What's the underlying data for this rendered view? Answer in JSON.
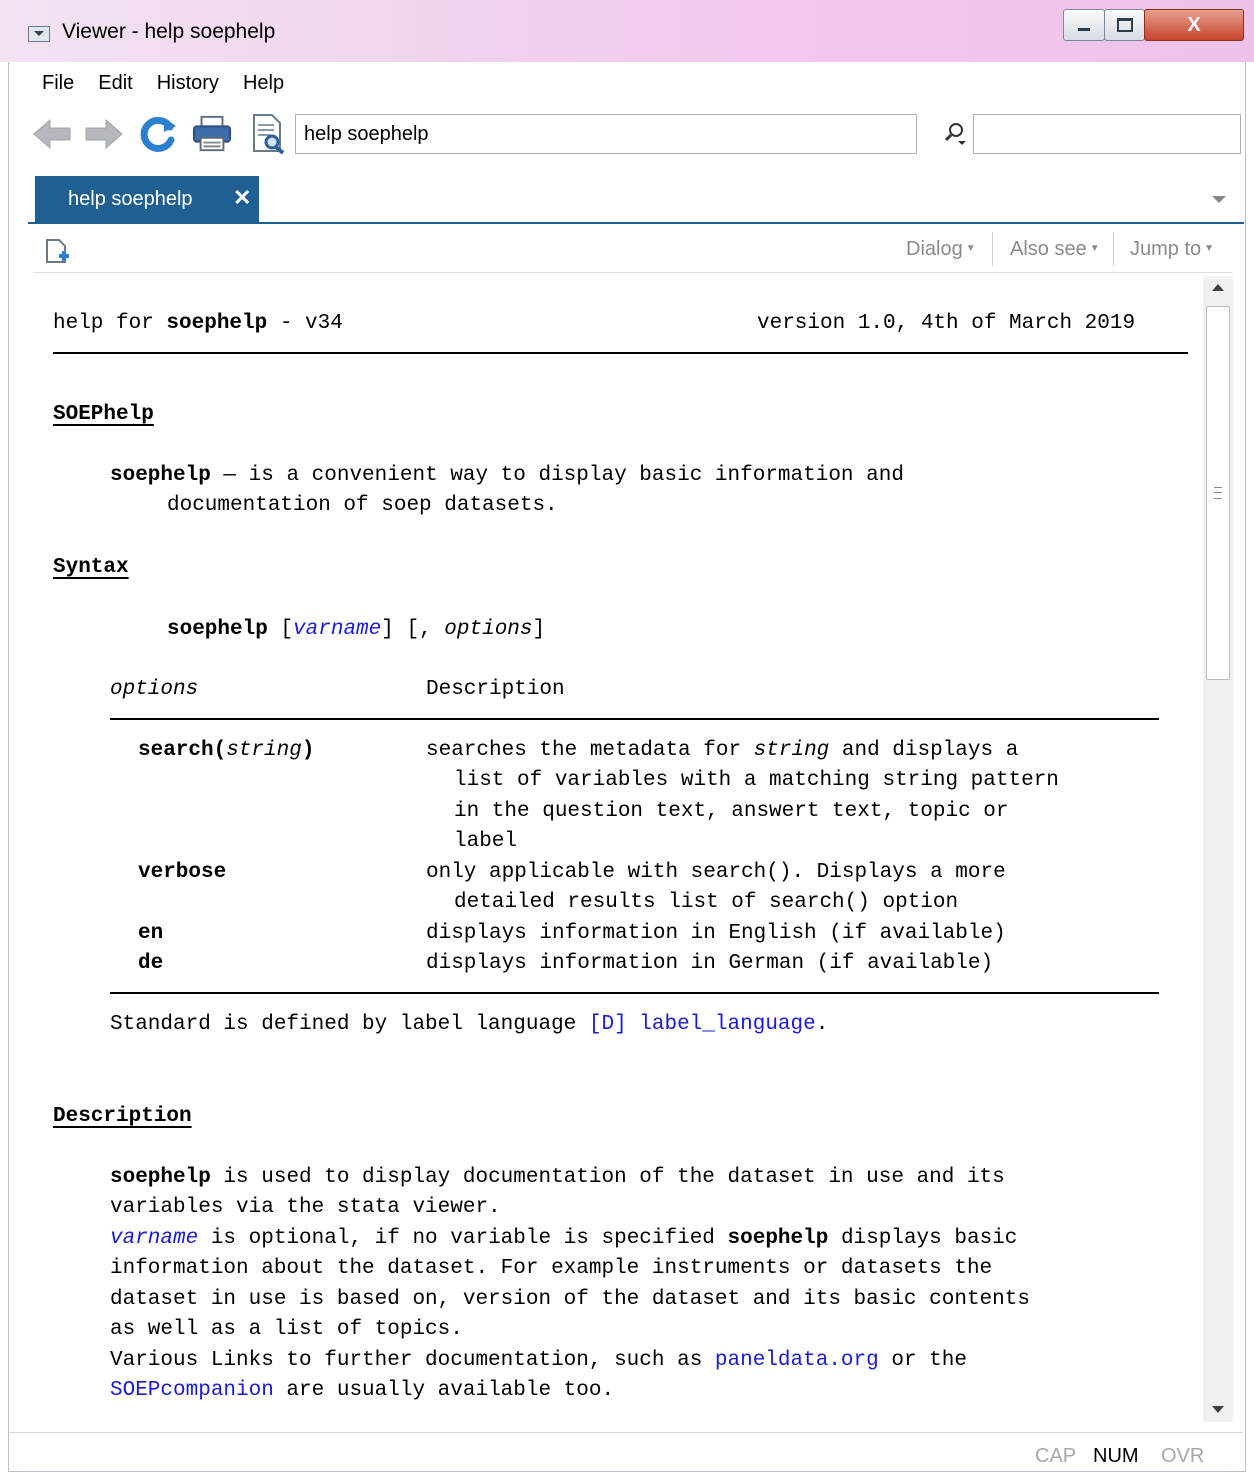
{
  "window": {
    "title": "Viewer - help soephelp",
    "close_symbol": "X"
  },
  "menu": [
    "File",
    "Edit",
    "History",
    "Help"
  ],
  "toolbar": {
    "address_value": "help soephelp"
  },
  "tab": {
    "label": "help soephelp",
    "close_symbol": "✕"
  },
  "subtoolbar": {
    "dialog": "Dialog",
    "also_see": "Also see",
    "jump_to": "Jump to"
  },
  "doc": {
    "header_left_pre": "help for ",
    "header_left_bold": "soephelp",
    "header_left_post": " - v34",
    "header_right": "version 1.0, 4th of March 2019",
    "heading_soephelp": "SOEPhelp",
    "intro_bold": "soephelp",
    "intro_rest": " — is a convenient way to display basic information and",
    "intro_line2": "documentation of soep datasets.",
    "heading_syntax": "Syntax",
    "syntax_cmd": "soephelp",
    "syntax_open": " [",
    "syntax_varname": "varname",
    "syntax_mid": "] [, ",
    "syntax_options": "options",
    "syntax_close": "]",
    "col_options": "options",
    "col_description": "Description",
    "opt_search_name": "search(",
    "opt_search_arg": "string",
    "opt_search_close": ")",
    "opt_search_desc_pre": "searches the metadata for ",
    "opt_search_desc_arg": "string",
    "opt_search_desc_post": " and displays a",
    "opt_search_l2": "list of variables with a matching string pattern",
    "opt_search_l3": "in the question text, answert text, topic or",
    "opt_search_l4": "label",
    "opt_verbose_name": "verbose",
    "opt_verbose_l1": "only applicable with search(). Displays a more",
    "opt_verbose_l2": "detailed results list of search() option",
    "opt_en_name": "en",
    "opt_en_desc": "displays information in English (if available)",
    "opt_de_name": "de",
    "opt_de_desc": "displays information in German (if available)",
    "standard_pre": "Standard is defined by label language ",
    "standard_link": "[D] label_language",
    "standard_post": ".",
    "heading_description": "Description",
    "d1_bold": "soephelp",
    "d1_rest": " is used to display documentation of the dataset in use and its",
    "d2": "variables via the stata viewer.",
    "d3_link": "varname",
    "d3_mid": " is optional, if no variable is specified ",
    "d3_bold": "soephelp",
    "d3_end": " displays basic",
    "d4": "information about the dataset. For example instruments or datasets the",
    "d5": "dataset in use is based on, version of the dataset and its basic contents",
    "d6": "as well as a list of topics.",
    "d7_pre": "Various Links to further documentation, such as ",
    "d7_link": "paneldata.org",
    "d7_post": " or the",
    "d8_link": "SOEPcompanion",
    "d8_post": " are usually available too."
  },
  "status": {
    "cap": "CAP",
    "num": "NUM",
    "ovr": "OVR"
  }
}
